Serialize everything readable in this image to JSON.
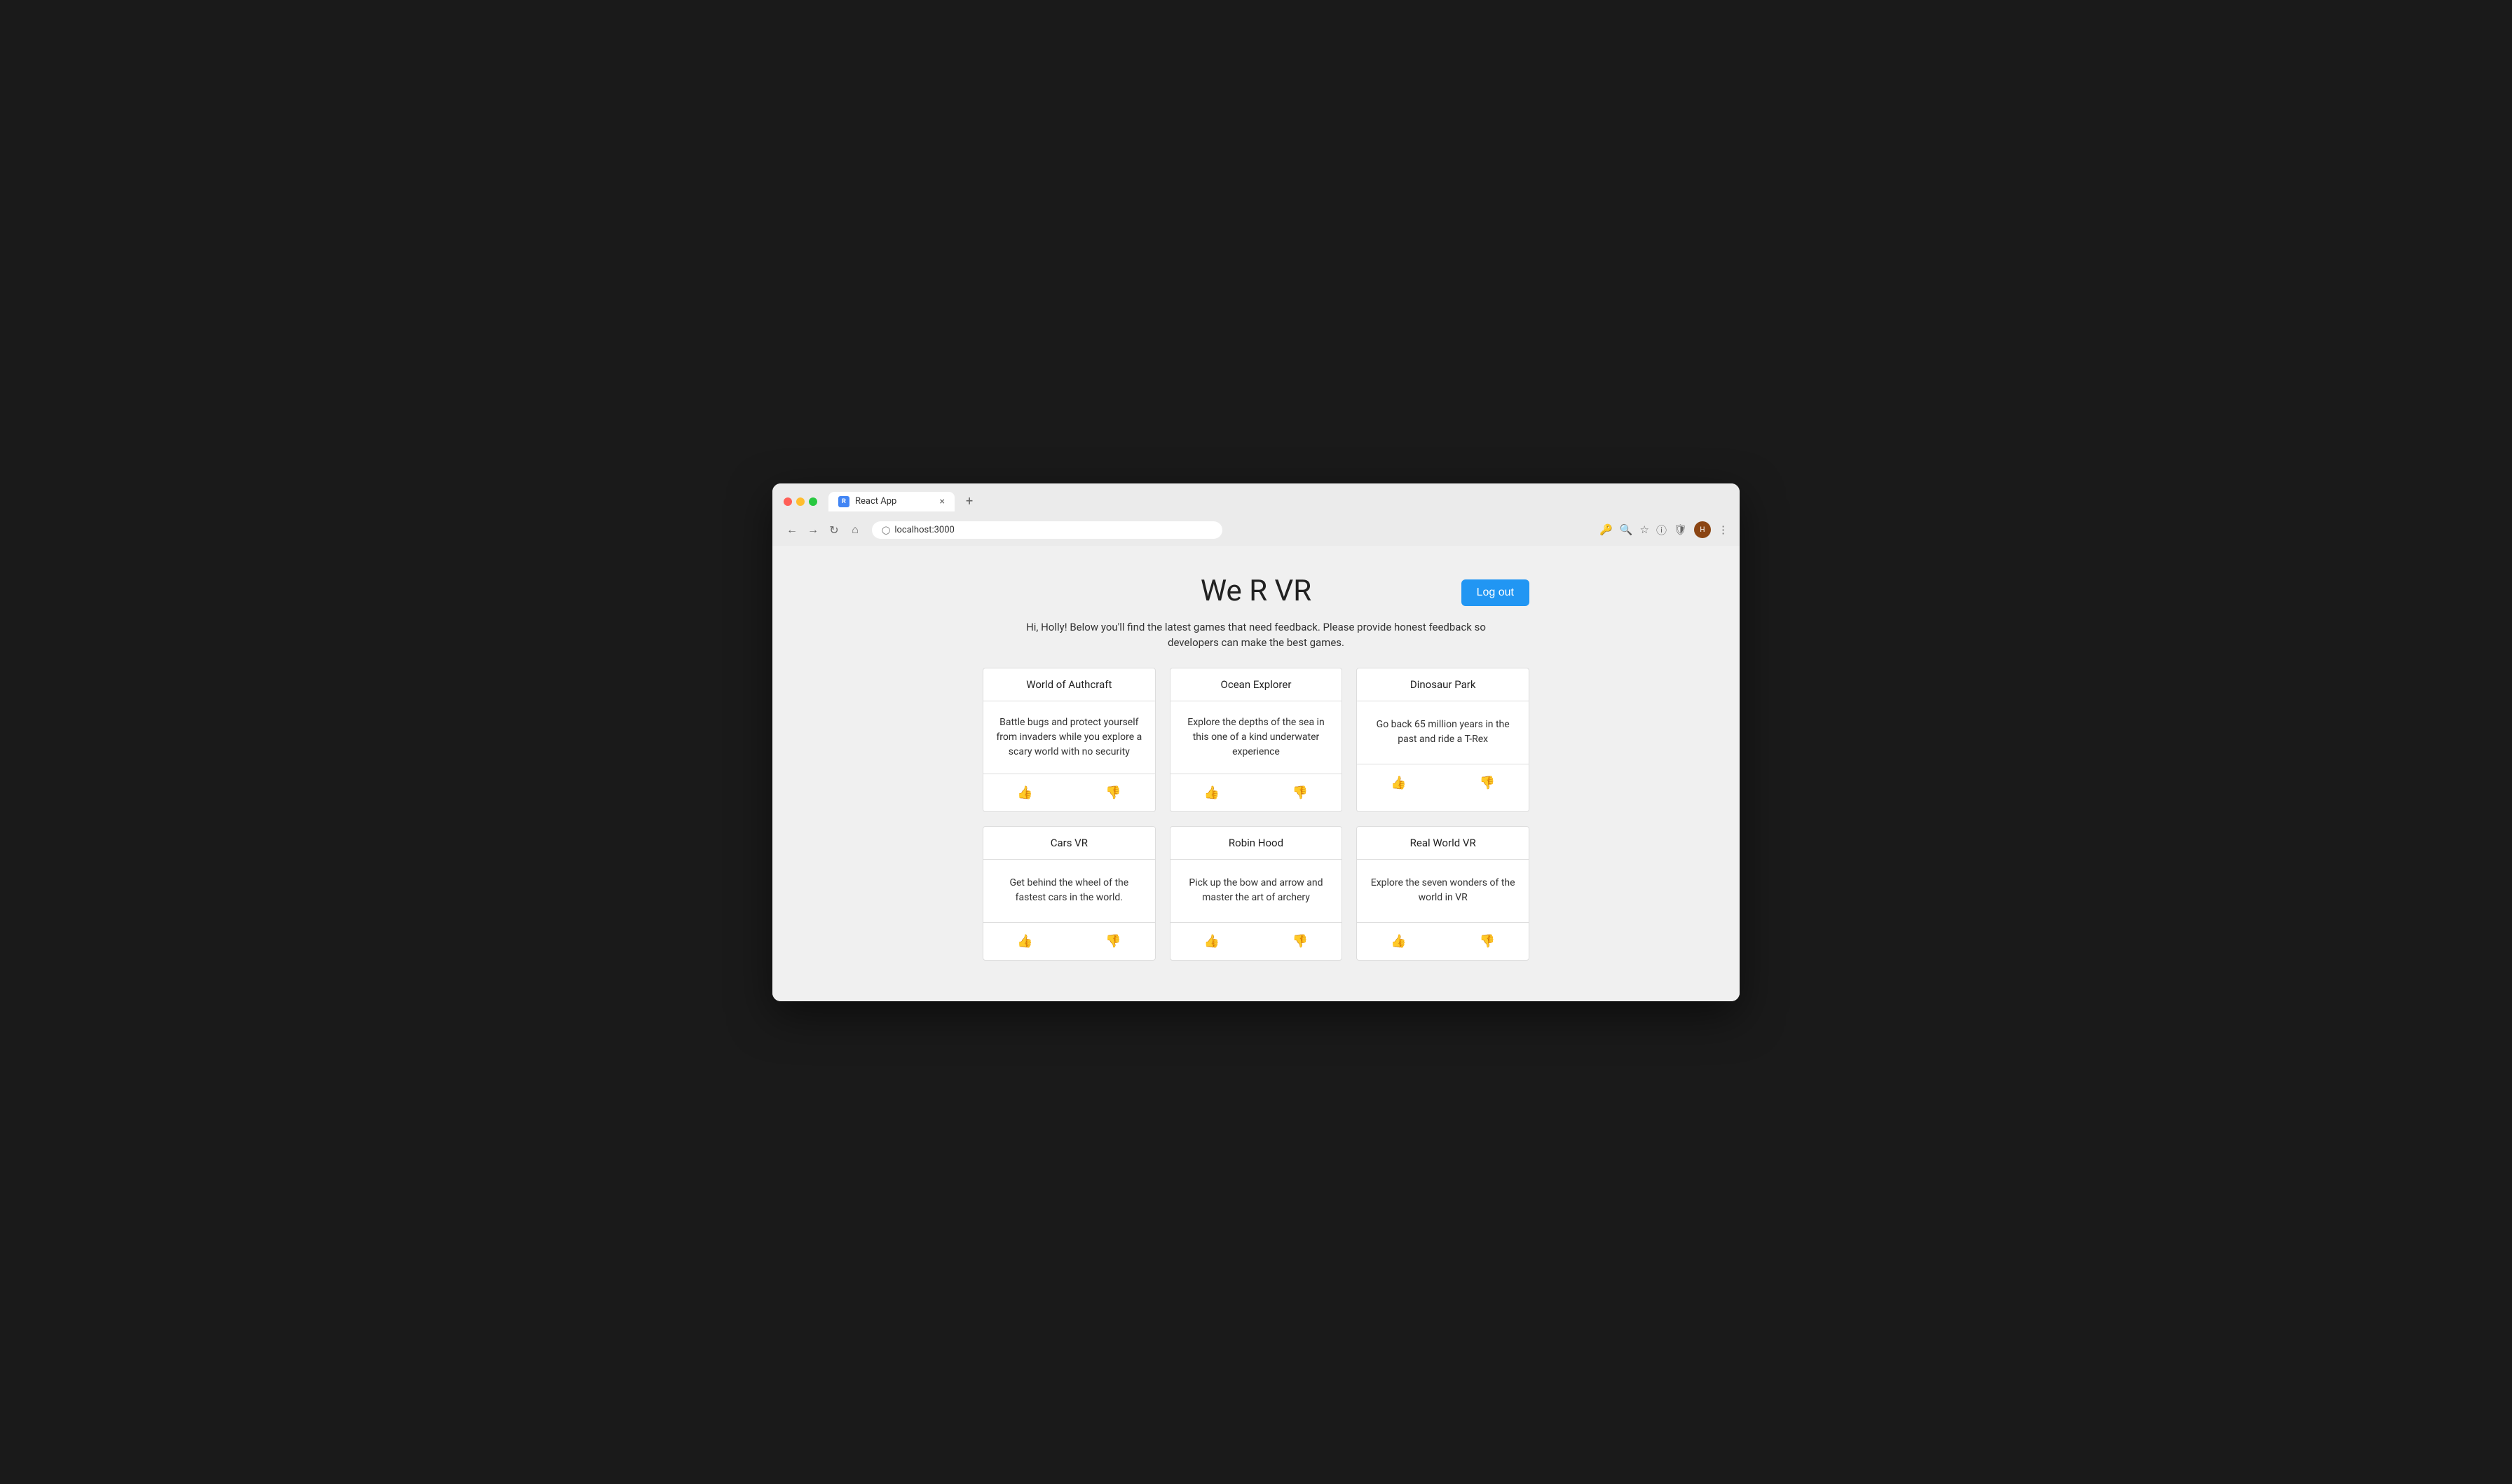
{
  "browser": {
    "tab_title": "React App",
    "tab_favicon_label": "R",
    "url": "localhost:3000",
    "close_label": "×",
    "new_tab_label": "+"
  },
  "app": {
    "title": "We R VR",
    "logout_label": "Log out",
    "welcome_text": "Hi, Holly! Below you'll find the latest games that need feedback. Please provide honest feedback so developers can make the best games.",
    "games": [
      {
        "id": "world-of-authcraft",
        "title": "World of Authcraft",
        "description": "Battle bugs and protect yourself from invaders while you explore a scary world with no security"
      },
      {
        "id": "ocean-explorer",
        "title": "Ocean Explorer",
        "description": "Explore the depths of the sea in this one of a kind underwater experience"
      },
      {
        "id": "dinosaur-park",
        "title": "Dinosaur Park",
        "description": "Go back 65 million years in the past and ride a T-Rex"
      },
      {
        "id": "cars-vr",
        "title": "Cars VR",
        "description": "Get behind the wheel of the fastest cars in the world."
      },
      {
        "id": "robin-hood",
        "title": "Robin Hood",
        "description": "Pick up the bow and arrow and master the art of archery"
      },
      {
        "id": "real-world-vr",
        "title": "Real World VR",
        "description": "Explore the seven wonders of the world in VR"
      }
    ],
    "thumbs_up_icon": "👍",
    "thumbs_down_icon": "👎"
  }
}
